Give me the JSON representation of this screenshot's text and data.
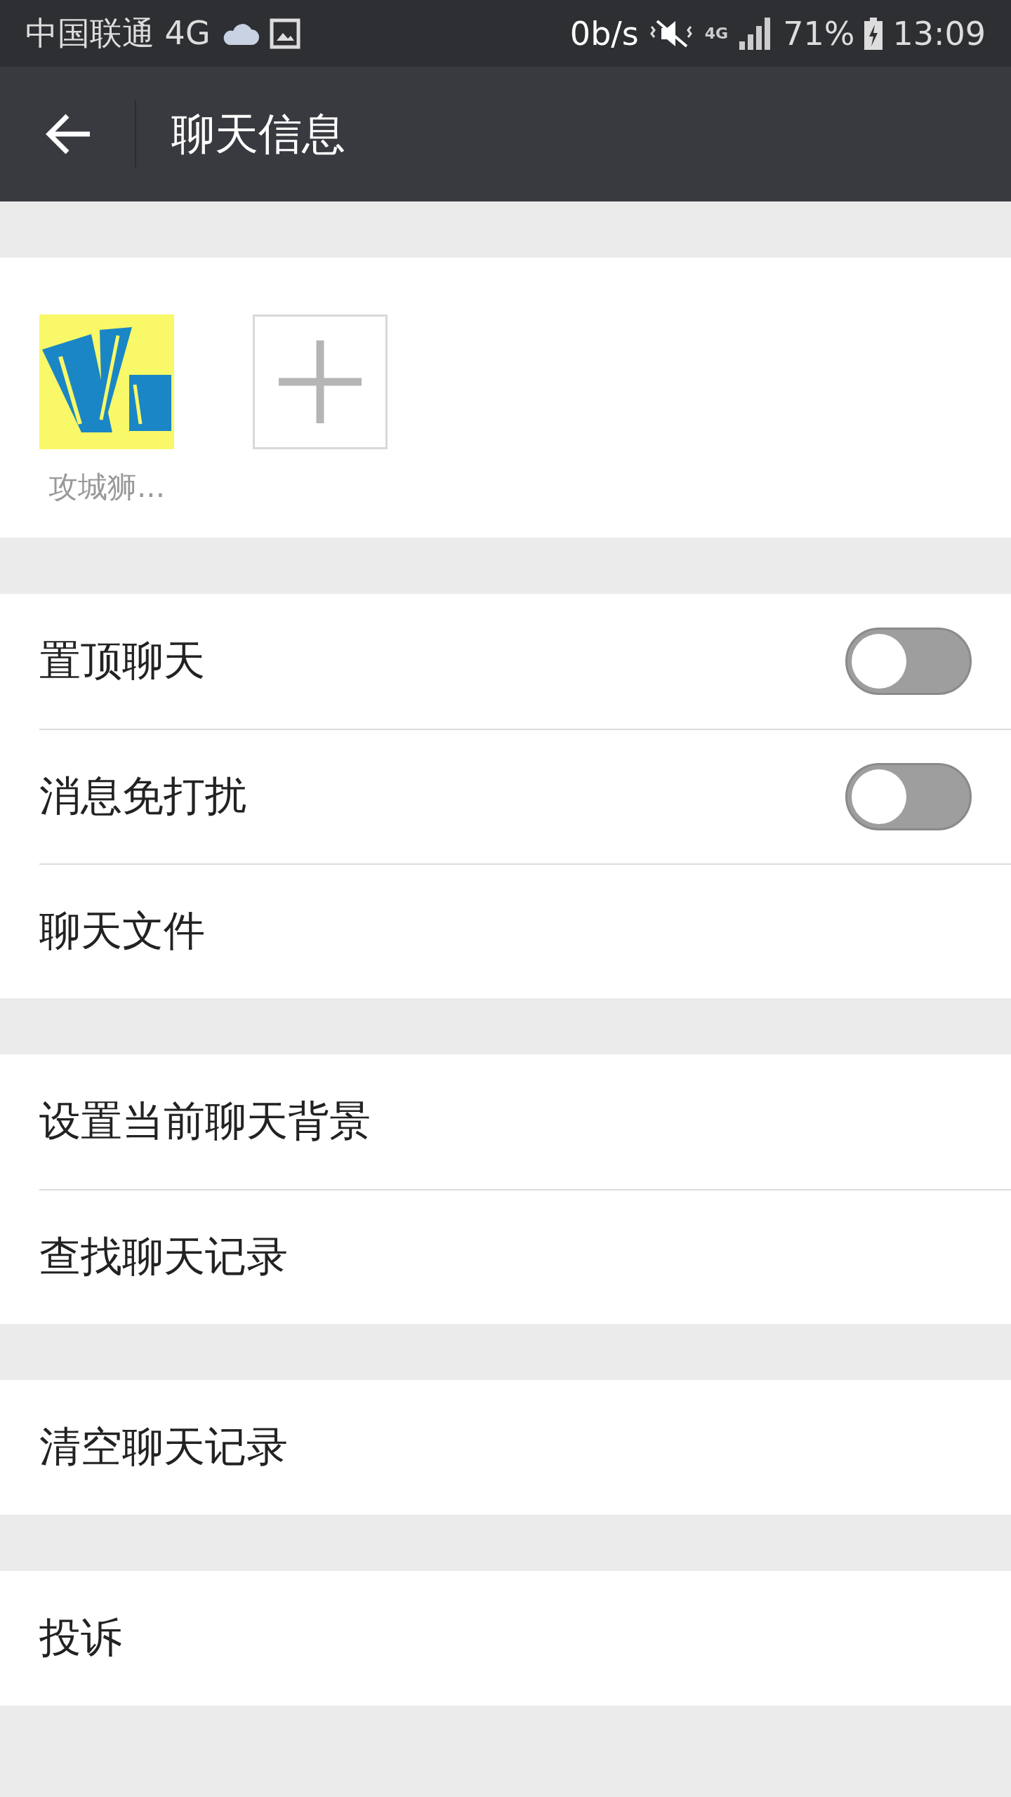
{
  "status_bar": {
    "carrier": "中国联通 4G",
    "speed": "0b/s",
    "network": "4G",
    "battery": "71%",
    "time": "13:09"
  },
  "app_bar": {
    "title": "聊天信息"
  },
  "members": [
    {
      "name": "攻城狮...",
      "kind": "picture"
    }
  ],
  "groups": [
    [
      {
        "label": "置顶聊天",
        "kind": "toggle",
        "on": false
      },
      {
        "label": "消息免打扰",
        "kind": "toggle",
        "on": false
      },
      {
        "label": "聊天文件",
        "kind": "link"
      }
    ],
    [
      {
        "label": "设置当前聊天背景",
        "kind": "link"
      },
      {
        "label": "查找聊天记录",
        "kind": "link"
      }
    ],
    [
      {
        "label": "清空聊天记录",
        "kind": "link"
      }
    ],
    [
      {
        "label": "投诉",
        "kind": "link"
      }
    ]
  ]
}
